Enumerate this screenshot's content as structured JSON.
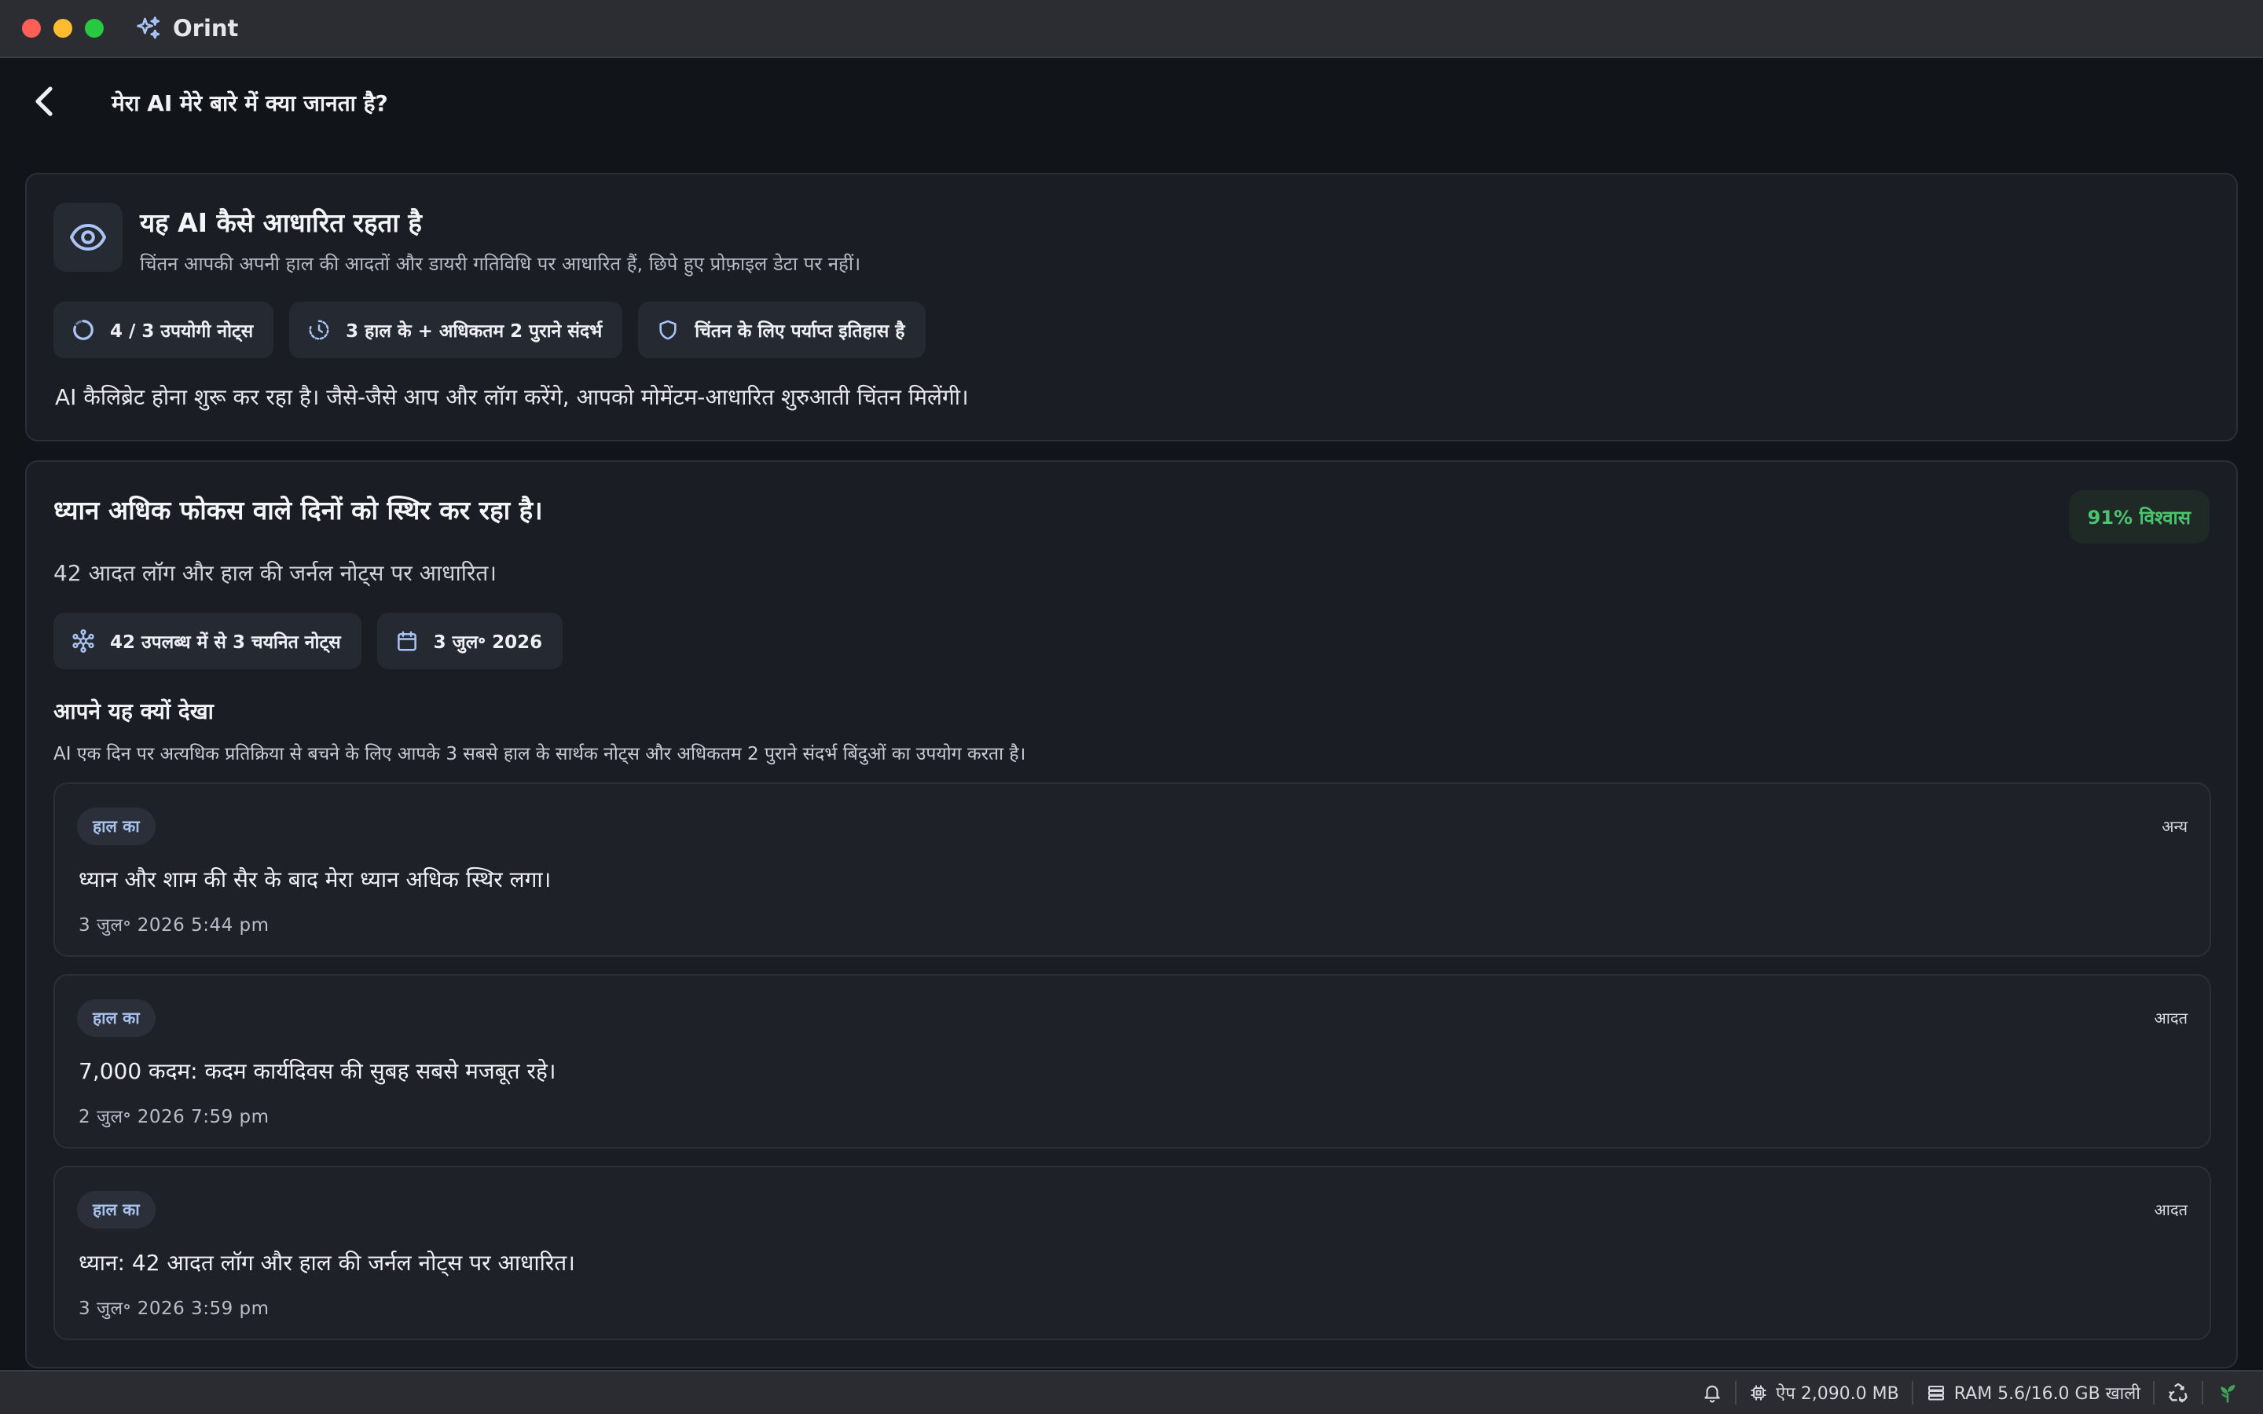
{
  "window": {
    "app_name": "Orint"
  },
  "header": {
    "title": "मेरा AI मेरे बारे में क्या जानता है?"
  },
  "about_card": {
    "title": "यह AI कैसे आधारित रहता है",
    "subtitle": "चिंतन आपकी अपनी हाल की आदतों और डायरी गतिविधि पर आधारित हैं, छिपे हुए प्रोफ़ाइल डेटा पर नहीं।",
    "chips": [
      {
        "icon": "progress-ring-icon",
        "label": "4 / 3 उपयोगी नोट्स"
      },
      {
        "icon": "history-clock-icon",
        "label": "3 हाल के + अधिकतम 2 पुराने संदर्भ"
      },
      {
        "icon": "shield-icon",
        "label": "चिंतन के लिए पर्याप्त इतिहास है"
      }
    ],
    "calibration_text": "AI कैलिब्रेट होना शुरू कर रहा है। जैसे-जैसे आप और लॉग करेंगे, आपको मोमेंटम-आधारित शुरुआती चिंतन मिलेंगी।"
  },
  "insight_card": {
    "title": "ध्यान अधिक फोकस वाले दिनों को स्थिर कर रहा है।",
    "confidence": "91% विश्वास",
    "based_on": "42 आदत लॉग और हाल की जर्नल नोट्स पर आधारित।",
    "chips": [
      {
        "icon": "network-nodes-icon",
        "label": "42 उपलब्ध में से 3 चयनित नोट्स"
      },
      {
        "icon": "calendar-icon",
        "label": "3 जुल॰ 2026"
      }
    ],
    "why_title": "आपने यह क्यों देखा",
    "why_desc": "AI एक दिन पर अत्यधिक प्रतिक्रिया से बचने के लिए आपके 3 सबसे हाल के सार्थक नोट्स और अधिकतम 2 पुराने संदर्भ बिंदुओं का उपयोग करता है।",
    "notes": [
      {
        "tag": "हाल का",
        "category": "अन्य",
        "text": "ध्यान और शाम की सैर के बाद मेरा ध्यान अधिक स्थिर लगा।",
        "time": "3 जुल॰ 2026 5:44 pm"
      },
      {
        "tag": "हाल का",
        "category": "आदत",
        "text": "7,000 कदम: कदम कार्यदिवस की सुबह सबसे मजबूत रहे।",
        "time": "2 जुल॰ 2026 7:59 pm"
      },
      {
        "tag": "हाल का",
        "category": "आदत",
        "text": "ध्यान: 42 आदत लॉग और हाल की जर्नल नोट्स पर आधारित।",
        "time": "3 जुल॰ 2026 3:59 pm"
      }
    ]
  },
  "status_bar": {
    "app_memory": "ऐप 2,090.0 MB",
    "ram": "RAM 5.6/16.0 GB खाली"
  },
  "colors": {
    "background": "#111419",
    "card": "#1a1d23",
    "accent_blue": "#a8c2ee",
    "confidence_green": "#4cc36e"
  }
}
